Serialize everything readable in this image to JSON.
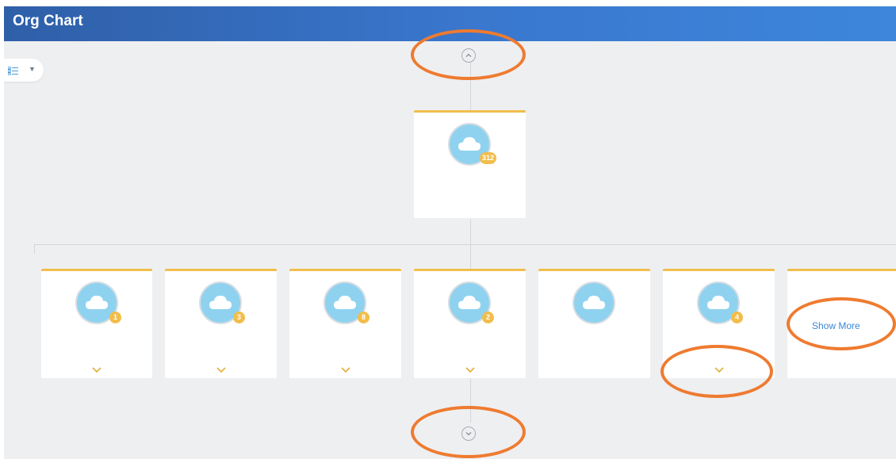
{
  "header": {
    "title": "Org Chart"
  },
  "top_card": {
    "badge": "312"
  },
  "cards": [
    {
      "badge": "1",
      "has_expand": true
    },
    {
      "badge": "3",
      "has_expand": true
    },
    {
      "badge": "8",
      "has_expand": true
    },
    {
      "badge": "2",
      "has_expand": true
    },
    {
      "badge": "",
      "has_expand": false
    },
    {
      "badge": "4",
      "has_expand": true
    }
  ],
  "show_more": {
    "label": "Show More"
  },
  "icons": {
    "view_toggle": "list-icon",
    "dropdown": "caret-down-icon",
    "nav_up": "chevron-up-circle-icon",
    "nav_down": "chevron-down-circle-icon",
    "avatar": "cloud-icon",
    "expand": "chevron-down-icon"
  },
  "colors": {
    "header_start": "#2f5fa8",
    "header_end": "#3d86dc",
    "card_accent": "#f1bd4b",
    "avatar_fill": "#8fd2ef",
    "link": "#3a88d6",
    "annotation": "#ee7b30"
  }
}
